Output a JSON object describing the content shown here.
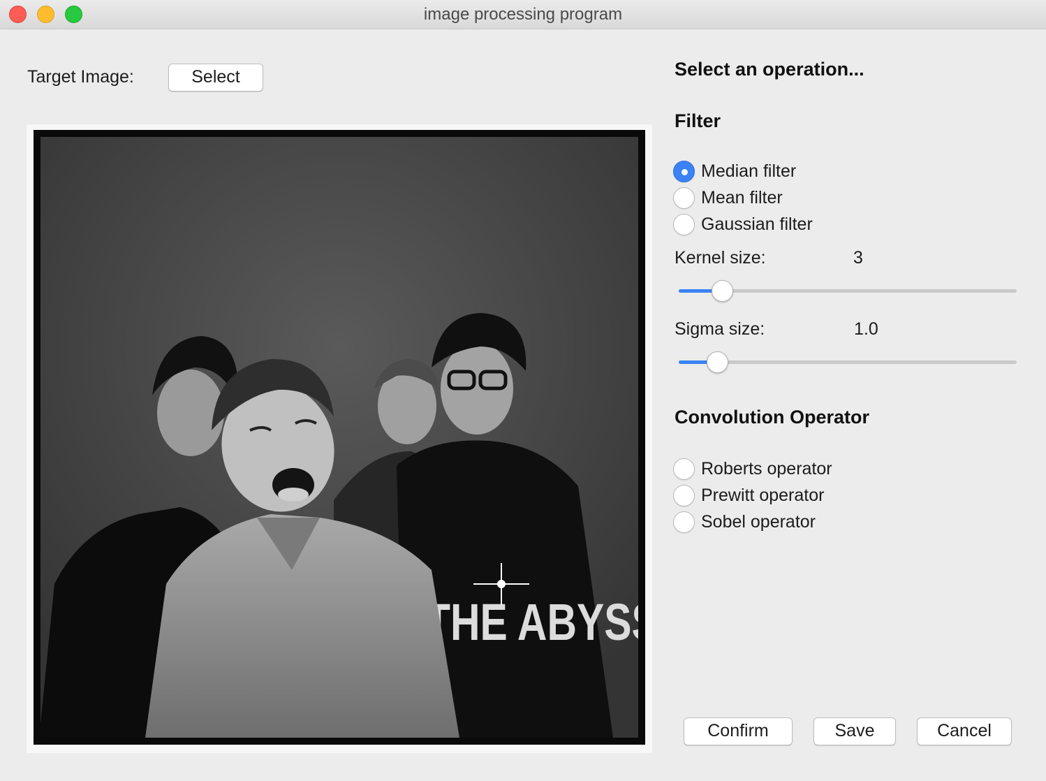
{
  "window": {
    "title": "image processing program"
  },
  "left": {
    "target_label": "Target Image:",
    "select_label": "Select",
    "photo": {
      "shirt_text": "THE ABYSS"
    }
  },
  "right": {
    "operation_heading": "Select an operation...",
    "filter_heading": "Filter",
    "filters": [
      {
        "label": "Median filter",
        "checked": true
      },
      {
        "label": "Mean filter",
        "checked": false
      },
      {
        "label": "Gaussian filter",
        "checked": false
      }
    ],
    "kernel": {
      "label": "Kernel size:",
      "value": "3",
      "level": 0.13
    },
    "sigma": {
      "label": "Sigma size:",
      "value": "1.0",
      "level": 0.115
    },
    "convolution_heading": "Convolution Operator",
    "operators": [
      {
        "label": "Roberts operator",
        "checked": false
      },
      {
        "label": "Prewitt operator",
        "checked": false
      },
      {
        "label": "Sobel operator",
        "checked": false
      }
    ]
  },
  "actions": {
    "confirm_label": "Confirm",
    "save_label": "Save",
    "cancel_label": "Cancel"
  },
  "colors": {
    "accent": "#3b82f6",
    "background": "#ececec"
  }
}
